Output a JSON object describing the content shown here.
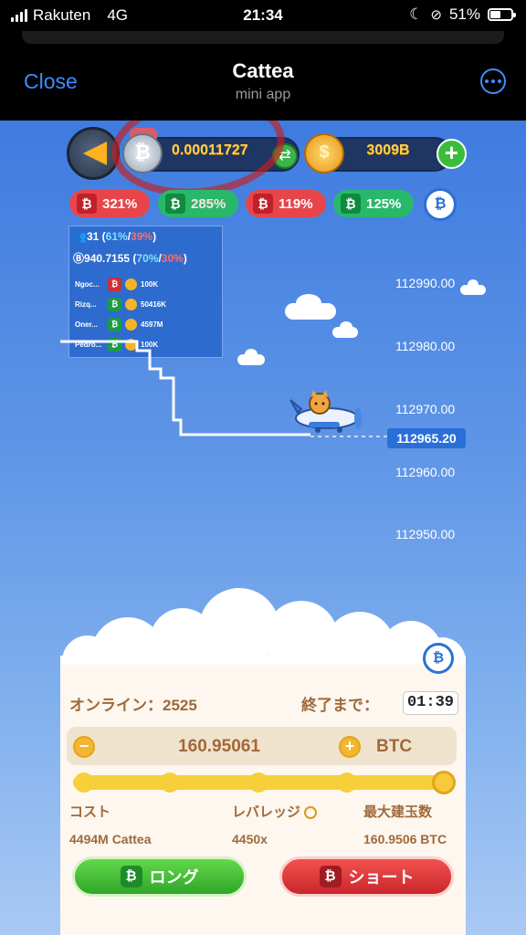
{
  "status_bar": {
    "carrier": "Rakuten",
    "network": "4G",
    "time": "21:34",
    "battery": "51%",
    "battery_level": 0.51
  },
  "nav": {
    "close_label": "Close",
    "title": "Cattea",
    "subtitle": "mini app"
  },
  "header": {
    "btc_balance": "0.00011727",
    "coin_balance": "3009B",
    "btc_symbol": "₿",
    "coin_symbol": "$"
  },
  "stat_pills": [
    {
      "value": "321%",
      "direction": "down",
      "color": "red"
    },
    {
      "value": "285%",
      "direction": "up",
      "color": "green"
    },
    {
      "value": "119%",
      "direction": "down",
      "color": "red"
    },
    {
      "value": "125%",
      "direction": "up",
      "color": "green"
    }
  ],
  "stats_panel": {
    "players": "31",
    "players_long": "61%",
    "players_short": "39%",
    "volume": "940.7155",
    "volume_long": "70%",
    "volume_short": "30%",
    "traders": [
      {
        "name": "Ngoc...",
        "direction": "down",
        "amount": "100K"
      },
      {
        "name": "Rizq...",
        "direction": "up",
        "amount": "50416K"
      },
      {
        "name": "Oner...",
        "direction": "up",
        "amount": "4597M"
      },
      {
        "name": "Pedro...",
        "direction": "up",
        "amount": "100K"
      }
    ]
  },
  "price_axis": [
    "112990.00",
    "112980.00",
    "112970.00",
    "112960.00",
    "112950.00"
  ],
  "current_price": "112965.20",
  "panel": {
    "online_label": "オンライン：2525",
    "until_label": "終了まで：",
    "timer": "01:39",
    "amount": "160.95061",
    "unit": "BTC",
    "leverage_level": 1.0,
    "cost_label": "コスト",
    "leverage_label": "レバレッジ",
    "max_label": "最大建玉数",
    "cost_value": "4494M Cattea",
    "leverage_value": "4450x",
    "max_value": "160.9506 BTC",
    "long_label": "ロング",
    "short_label": "ショート"
  },
  "colors": {
    "sky_top": "#3f7be0",
    "long_green": "#2fa629",
    "short_red": "#c9262c",
    "panel_brown": "#a0693a",
    "ios_blue": "#3f8cff"
  }
}
